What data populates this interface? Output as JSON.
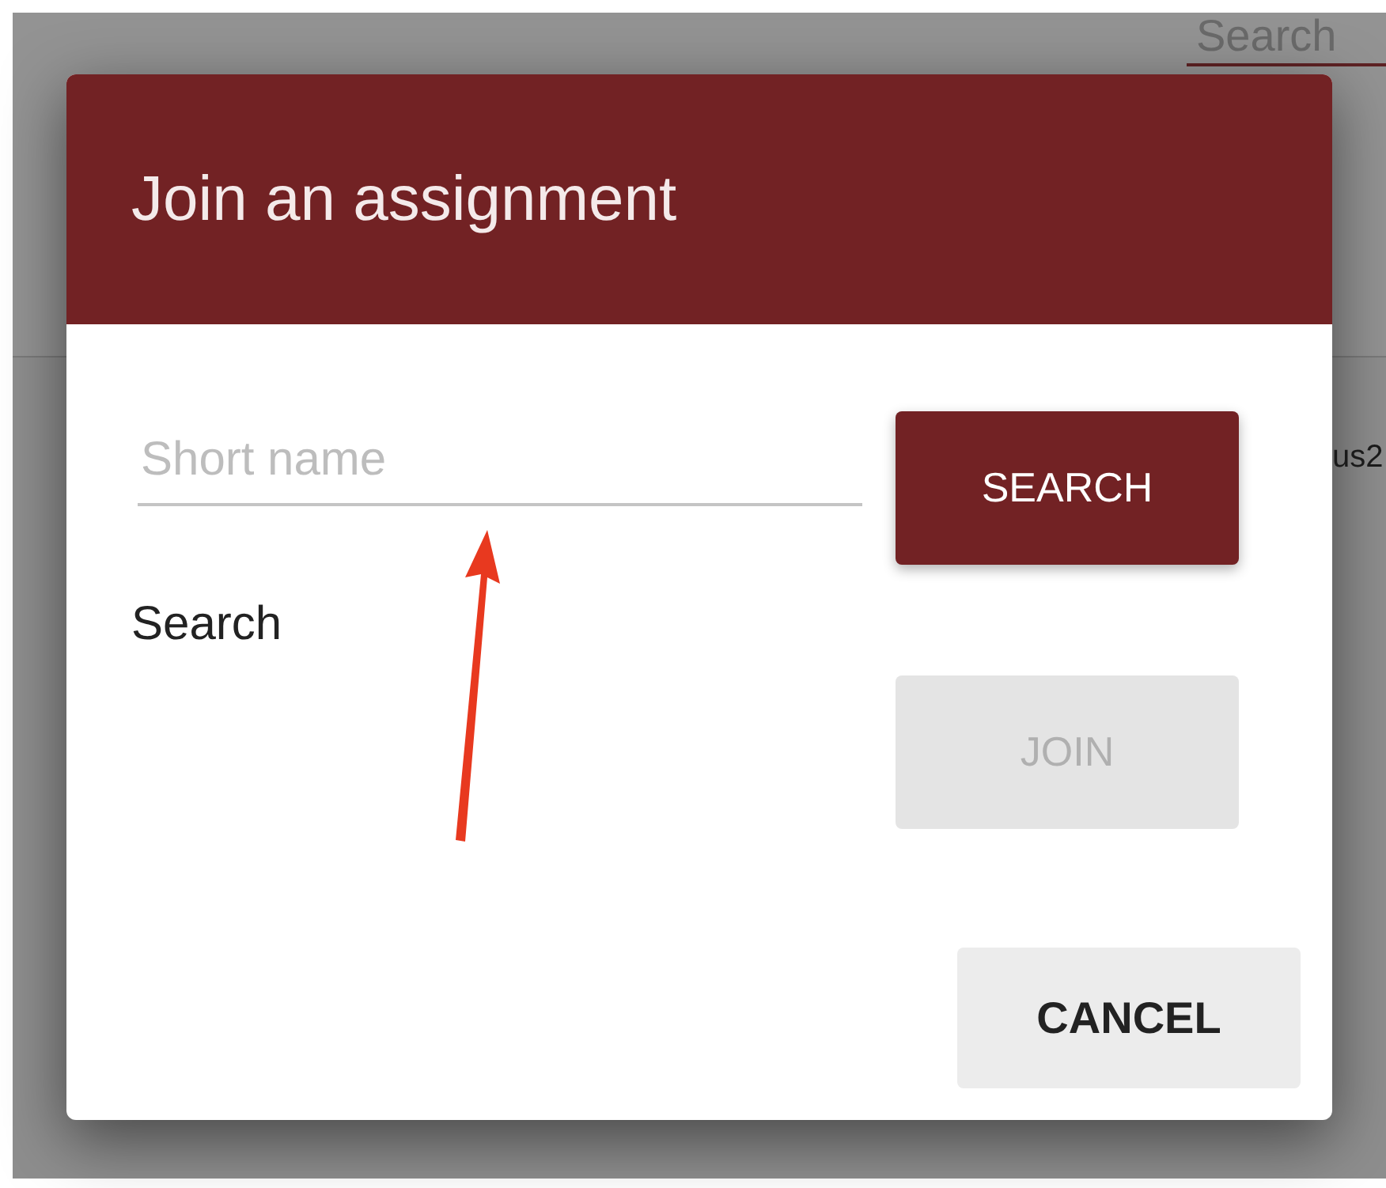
{
  "background": {
    "tab": {
      "label": "Search",
      "selected": true
    },
    "row_text": "us2"
  },
  "dialog": {
    "title": "Join an assignment",
    "field": {
      "placeholder": "Short name"
    },
    "search_button": {
      "label": "SEARCH",
      "disabled": false
    },
    "status_text": "Search",
    "join_button": {
      "label": "JOIN",
      "disabled": true
    },
    "cancel_button": {
      "label": "CANCEL"
    }
  }
}
